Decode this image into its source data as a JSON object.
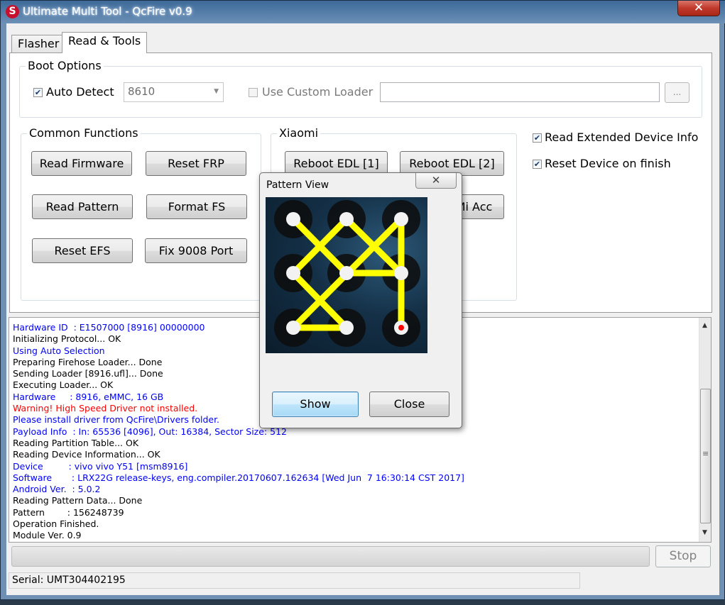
{
  "window": {
    "title": "Ultimate Multi Tool - QcFire v0.9",
    "close_glyph": "✕"
  },
  "tabs": [
    "Flasher",
    "Read & Tools"
  ],
  "boot_options": {
    "label": "Boot Options",
    "auto_detect_label": "Auto Detect",
    "auto_detect_checked": true,
    "chip_value": "8610",
    "custom_loader_label": "Use Custom Loader",
    "custom_loader_checked": false,
    "loader_path": "",
    "browse_label": "..."
  },
  "common_functions": {
    "label": "Common Functions",
    "buttons": [
      "Read Firmware",
      "Reset FRP",
      "Read Pattern",
      "Format FS",
      "Reset EFS",
      "Fix 9008 Port"
    ]
  },
  "xiaomi": {
    "label": "Xiaomi",
    "buttons": [
      "Reboot EDL [1]",
      "Reboot EDL [2]",
      "Mi Acc"
    ]
  },
  "options": {
    "read_extended_label": "Read Extended Device Info",
    "read_extended_checked": true,
    "reset_device_label": "Reset Device on finish",
    "reset_device_checked": true
  },
  "log": [
    {
      "text": "Hardware ID  : E1507000 [8916] 00000000",
      "color": "#0000ff"
    },
    {
      "text": "Initializing Protocol... OK",
      "color": "#000000"
    },
    {
      "text": "Using Auto Selection",
      "color": "#0000ff"
    },
    {
      "text": "Preparing Firehose Loader... Done",
      "color": "#000000"
    },
    {
      "text": "Sending Loader [8916.ufl]... Done",
      "color": "#000000"
    },
    {
      "text": "Executing Loader... OK",
      "color": "#000000"
    },
    {
      "text": "Hardware     : 8916, eMMC, 16 GB",
      "color": "#0000ff"
    },
    {
      "text": "Warning! High Speed Driver not installed.",
      "color": "#ff0000"
    },
    {
      "text": "Please install driver from QcFire\\Drivers folder.",
      "color": "#0000ff"
    },
    {
      "text": "Payload Info  : In: 65536 [4096], Out: 16384, Sector Size: 512",
      "color": "#0000ff"
    },
    {
      "text": "Reading Partition Table... OK",
      "color": "#000000"
    },
    {
      "text": "Reading Device Information... OK",
      "color": "#000000"
    },
    {
      "text": "Device         : vivo vivo Y51 [msm8916]",
      "color": "#0000ff"
    },
    {
      "text": "Software       : LRX22G release-keys, eng.compiler.20170607.162634 [Wed Jun  7 16:30:14 CST 2017]",
      "color": "#0000ff"
    },
    {
      "text": "Android Ver.  : 5.0.2",
      "color": "#0000ff"
    },
    {
      "text": "Reading Pattern Data... Done",
      "color": "#000000"
    },
    {
      "text": "Pattern        : 156248739",
      "color": "#000000"
    },
    {
      "text": "Operation Finished.",
      "color": "#000000"
    },
    {
      "text": "Module Ver. 0.9",
      "color": "#000000"
    }
  ],
  "progress": 0,
  "stop_label": "Stop",
  "status": {
    "serial": "Serial: UMT304402195"
  },
  "pattern_dialog": {
    "title": "Pattern View",
    "close_glyph": "✕",
    "pattern": "156248739",
    "show_label": "Show",
    "close_label": "Close",
    "line_color": "#ffff00",
    "end_dot_color": "#ff0000"
  },
  "scroll_arrows": {
    "up": "▲",
    "down": "▼",
    "grip": "≡"
  }
}
